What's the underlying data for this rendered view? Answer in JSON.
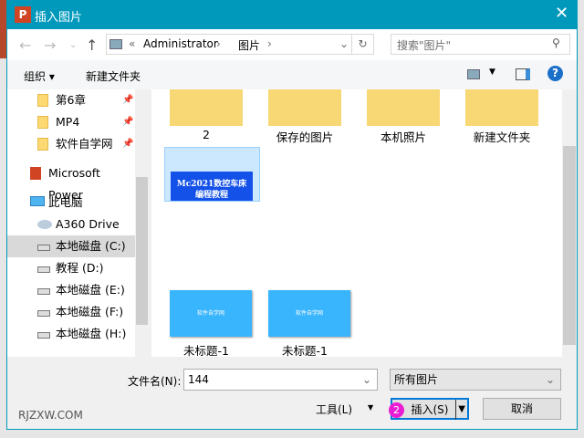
{
  "window": {
    "title": "插入图片",
    "app_icon": "P",
    "close": "✕"
  },
  "address": {
    "prefix": "«",
    "crumbs": [
      "Administrator",
      "图片"
    ],
    "sep": "›",
    "search_placeholder": "搜索\"图片\""
  },
  "toolbar": {
    "organize": "组织 ▾",
    "new_folder": "新建文件夹",
    "help": "?"
  },
  "nav": {
    "quick": [
      {
        "label": "第6章"
      },
      {
        "label": "MP4"
      },
      {
        "label": "软件自学网"
      }
    ],
    "powerpoint": "Microsoft Power",
    "pc": "此电脑",
    "drives": [
      {
        "label": "A360 Drive"
      },
      {
        "label": "本地磁盘 (C:)"
      },
      {
        "label": "教程 (D:)"
      },
      {
        "label": "本地磁盘 (E:)"
      },
      {
        "label": "本地磁盘 (F:)"
      },
      {
        "label": "本地磁盘 (H:)"
      }
    ]
  },
  "files": {
    "folders": [
      "2",
      "保存的图片",
      "本机照片",
      "新建文件夹"
    ],
    "selected_thumb_text": "Mc2021数控车床编程教程",
    "images": [
      {
        "label": "未标题-1",
        "thumb": "软件自学网"
      },
      {
        "label": "未标题-1",
        "thumb": "软件自学网"
      }
    ]
  },
  "bottom": {
    "filename_label": "文件名(N):",
    "filename": "144",
    "filter": "所有图片",
    "tools": "工具(L)",
    "insert": "插入(S)",
    "cancel": "取消",
    "badge": "2",
    "watermark": "RJZXW.COM"
  }
}
